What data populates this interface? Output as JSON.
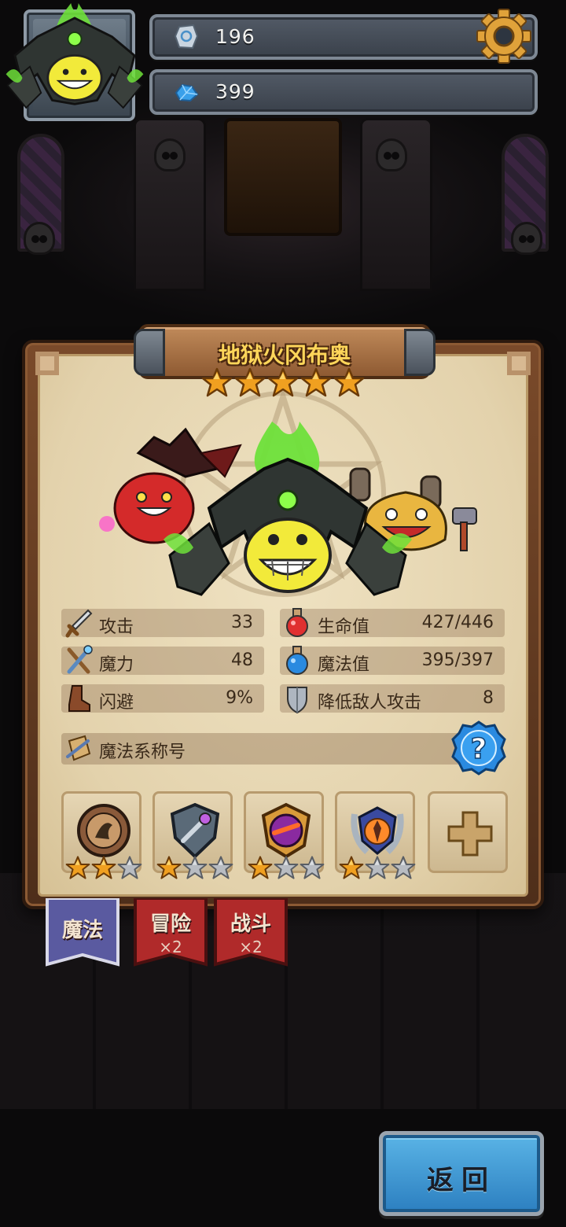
{
  "hud": {
    "rune_count": "196",
    "gem_count": "399"
  },
  "hero": {
    "name": "地狱火冈布奥",
    "rarity_stars": 5
  },
  "stats": {
    "attack": {
      "label": "攻击",
      "value": "33"
    },
    "power": {
      "label": "魔力",
      "value": "48"
    },
    "dodge": {
      "label": "闪避",
      "value": "9%"
    },
    "hp": {
      "label": "生命值",
      "value": "427/446"
    },
    "mp": {
      "label": "魔法值",
      "value": "395/397"
    },
    "armor": {
      "label": "降低敌人攻击",
      "value": "8"
    }
  },
  "magic_title": {
    "label": "魔法系称号"
  },
  "skills": [
    {
      "stars": 2,
      "max": 3,
      "color": "#8a5a3a"
    },
    {
      "stars": 1,
      "max": 3,
      "color": "#5a6a78"
    },
    {
      "stars": 1,
      "max": 3,
      "color": "#b0452a"
    },
    {
      "stars": 1,
      "max": 3,
      "color": "#d07820"
    }
  ],
  "tabs": {
    "magic": {
      "label": "魔法"
    },
    "adventure": {
      "label": "冒险",
      "mult": "×2"
    },
    "battle": {
      "label": "战斗",
      "mult": "×2"
    }
  },
  "back_button": {
    "label": "返回"
  },
  "colors": {
    "title_gold": "#ffd65a",
    "parchment": "#e3d2ac",
    "tab_active": "#5a5aa0",
    "tab_inactive": "#b02a2a",
    "back_blue": "#3a9ad6"
  }
}
